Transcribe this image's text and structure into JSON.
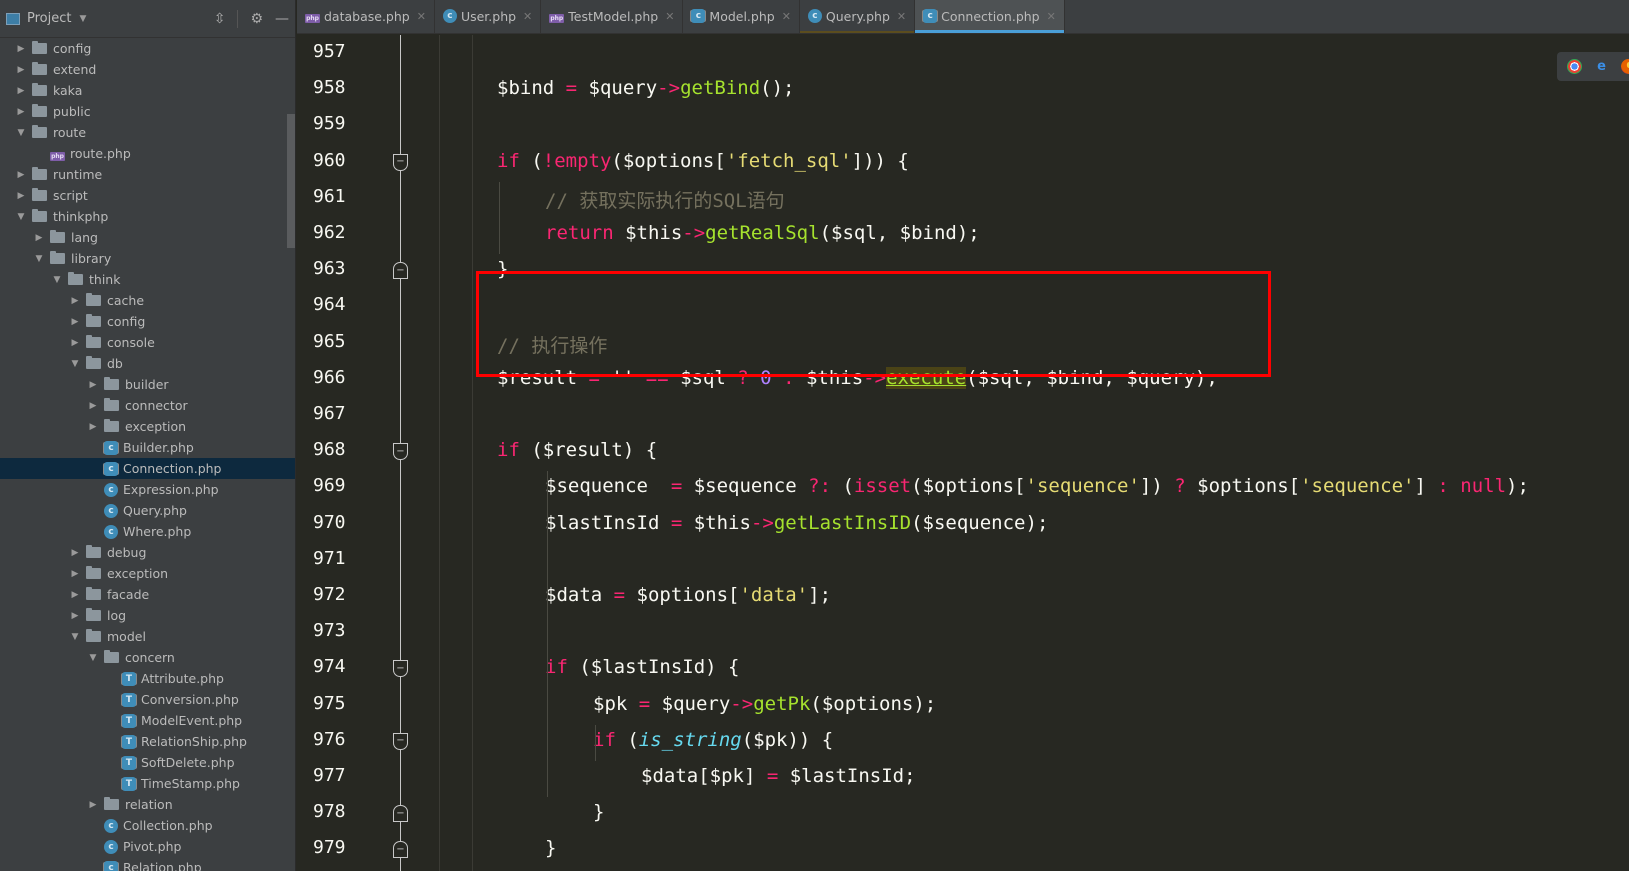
{
  "sidebar": {
    "title": "Project",
    "tools": [
      "collapse-all-icon",
      "gear-icon",
      "minimize-icon"
    ],
    "items": [
      {
        "label": "config",
        "type": "folder",
        "depth": 0,
        "expanded": false
      },
      {
        "label": "extend",
        "type": "folder",
        "depth": 0,
        "expanded": false
      },
      {
        "label": "kaka",
        "type": "folder",
        "depth": 0,
        "expanded": false
      },
      {
        "label": "public",
        "type": "folder",
        "depth": 0,
        "expanded": false
      },
      {
        "label": "route",
        "type": "folder",
        "depth": 0,
        "expanded": true
      },
      {
        "label": "route.php",
        "type": "php",
        "depth": 1
      },
      {
        "label": "runtime",
        "type": "folder",
        "depth": 0,
        "expanded": false
      },
      {
        "label": "script",
        "type": "folder",
        "depth": 0,
        "expanded": false
      },
      {
        "label": "thinkphp",
        "type": "folder",
        "depth": 0,
        "expanded": true
      },
      {
        "label": "lang",
        "type": "folder",
        "depth": 1,
        "expanded": false
      },
      {
        "label": "library",
        "type": "folder",
        "depth": 1,
        "expanded": true
      },
      {
        "label": "think",
        "type": "folder",
        "depth": 2,
        "expanded": true
      },
      {
        "label": "cache",
        "type": "folder",
        "depth": 3,
        "expanded": false
      },
      {
        "label": "config",
        "type": "folder",
        "depth": 3,
        "expanded": false
      },
      {
        "label": "console",
        "type": "folder",
        "depth": 3,
        "expanded": false
      },
      {
        "label": "db",
        "type": "folder",
        "depth": 3,
        "expanded": true
      },
      {
        "label": "builder",
        "type": "folder",
        "depth": 4,
        "expanded": false
      },
      {
        "label": "connector",
        "type": "folder",
        "depth": 4,
        "expanded": false
      },
      {
        "label": "exception",
        "type": "folder",
        "depth": 4,
        "expanded": false
      },
      {
        "label": "Builder.php",
        "type": "abstract-class",
        "depth": 4
      },
      {
        "label": "Connection.php",
        "type": "abstract-class",
        "depth": 4,
        "selected": true
      },
      {
        "label": "Expression.php",
        "type": "class",
        "depth": 4
      },
      {
        "label": "Query.php",
        "type": "class",
        "depth": 4
      },
      {
        "label": "Where.php",
        "type": "class",
        "depth": 4
      },
      {
        "label": "debug",
        "type": "folder",
        "depth": 3,
        "expanded": false
      },
      {
        "label": "exception",
        "type": "folder",
        "depth": 3,
        "expanded": false
      },
      {
        "label": "facade",
        "type": "folder",
        "depth": 3,
        "expanded": false
      },
      {
        "label": "log",
        "type": "folder",
        "depth": 3,
        "expanded": false
      },
      {
        "label": "model",
        "type": "folder",
        "depth": 3,
        "expanded": true
      },
      {
        "label": "concern",
        "type": "folder",
        "depth": 4,
        "expanded": true
      },
      {
        "label": "Attribute.php",
        "type": "trait",
        "depth": 5
      },
      {
        "label": "Conversion.php",
        "type": "trait",
        "depth": 5
      },
      {
        "label": "ModelEvent.php",
        "type": "trait",
        "depth": 5
      },
      {
        "label": "RelationShip.php",
        "type": "trait",
        "depth": 5
      },
      {
        "label": "SoftDelete.php",
        "type": "trait",
        "depth": 5
      },
      {
        "label": "TimeStamp.php",
        "type": "trait",
        "depth": 5
      },
      {
        "label": "relation",
        "type": "folder",
        "depth": 4,
        "expanded": false
      },
      {
        "label": "Collection.php",
        "type": "class",
        "depth": 4
      },
      {
        "label": "Pivot.php",
        "type": "class",
        "depth": 4
      },
      {
        "label": "Relation.php",
        "type": "abstract-class",
        "depth": 4
      }
    ]
  },
  "tabs": [
    {
      "label": "database.php",
      "icon": "php",
      "active": false
    },
    {
      "label": "User.php",
      "icon": "class",
      "active": false
    },
    {
      "label": "TestModel.php",
      "icon": "php",
      "active": false
    },
    {
      "label": "Model.php",
      "icon": "abstract-class",
      "active": false
    },
    {
      "label": "Query.php",
      "icon": "class",
      "active": false
    },
    {
      "label": "Connection.php",
      "icon": "abstract-class",
      "active": true
    }
  ],
  "editor": {
    "lines": [
      {
        "n": "957",
        "indent": 0,
        "tokens": []
      },
      {
        "n": "958",
        "indent": 0,
        "tokens": [
          [
            "",
            "$bind "
          ],
          [
            "kw",
            "="
          ],
          [
            "",
            " $query"
          ],
          [
            "kw",
            "->"
          ],
          [
            "fn",
            "getBind"
          ],
          [
            "",
            "();"
          ]
        ]
      },
      {
        "n": "959",
        "indent": 0,
        "tokens": []
      },
      {
        "n": "960",
        "indent": 0,
        "fold": "open",
        "tokens": [
          [
            "kw",
            "if"
          ],
          [
            "",
            " ("
          ],
          [
            "kw",
            "!empty"
          ],
          [
            "",
            "($options["
          ],
          [
            "str",
            "'fetch_sql'"
          ],
          [
            "",
            "])) {"
          ]
        ]
      },
      {
        "n": "961",
        "indent": 1,
        "tokens": [
          [
            "cm",
            "// 获取实际执行的SQL语句"
          ]
        ]
      },
      {
        "n": "962",
        "indent": 1,
        "tokens": [
          [
            "kw",
            "return"
          ],
          [
            "",
            " $this"
          ],
          [
            "kw",
            "->"
          ],
          [
            "fn",
            "getRealSql"
          ],
          [
            "",
            "($sql, $bind);"
          ]
        ]
      },
      {
        "n": "963",
        "indent": 0,
        "fold": "close",
        "tokens": [
          [
            "",
            "}"
          ]
        ]
      },
      {
        "n": "964",
        "indent": 0,
        "tokens": []
      },
      {
        "n": "965",
        "indent": 0,
        "tokens": [
          [
            "cm",
            "// 执行操作"
          ]
        ]
      },
      {
        "n": "966",
        "indent": 0,
        "tokens": [
          [
            "",
            "$result "
          ],
          [
            "kw",
            "="
          ],
          [
            "",
            " '' "
          ],
          [
            "kw",
            "=="
          ],
          [
            "",
            " $sql "
          ],
          [
            "kw",
            "?"
          ],
          [
            "",
            " "
          ],
          [
            "num",
            "0"
          ],
          [
            "",
            " "
          ],
          [
            "kw",
            ":"
          ],
          [
            "",
            " $this"
          ],
          [
            "kw",
            "->"
          ],
          [
            "fnhl",
            "execute"
          ],
          [
            "",
            "($sql, $bind, $query);"
          ]
        ]
      },
      {
        "n": "967",
        "indent": 0,
        "tokens": []
      },
      {
        "n": "968",
        "indent": 0,
        "fold": "open",
        "tokens": [
          [
            "kw",
            "if"
          ],
          [
            "",
            " ($result) {"
          ]
        ]
      },
      {
        "n": "969",
        "indent": 1,
        "tokens": [
          [
            "",
            "$sequence  "
          ],
          [
            "kw",
            "="
          ],
          [
            "",
            " $sequence "
          ],
          [
            "kw",
            "?:"
          ],
          [
            "",
            " ("
          ],
          [
            "kw",
            "isset"
          ],
          [
            "",
            "($options["
          ],
          [
            "str",
            "'sequence'"
          ],
          [
            "",
            "]) "
          ],
          [
            "kw",
            "?"
          ],
          [
            "",
            " $options["
          ],
          [
            "str",
            "'sequence'"
          ],
          [
            "",
            "] "
          ],
          [
            "kw",
            ":"
          ],
          [
            "",
            " "
          ],
          [
            "kw",
            "null"
          ],
          [
            "",
            ");"
          ]
        ]
      },
      {
        "n": "970",
        "indent": 1,
        "tokens": [
          [
            "",
            "$lastInsId "
          ],
          [
            "kw",
            "="
          ],
          [
            "",
            " $this"
          ],
          [
            "kw",
            "->"
          ],
          [
            "fn",
            "getLastInsID"
          ],
          [
            "",
            "($sequence);"
          ]
        ]
      },
      {
        "n": "971",
        "indent": 1,
        "tokens": []
      },
      {
        "n": "972",
        "indent": 1,
        "tokens": [
          [
            "",
            "$data "
          ],
          [
            "kw",
            "="
          ],
          [
            "",
            " $options["
          ],
          [
            "str",
            "'data'"
          ],
          [
            "",
            "];"
          ]
        ]
      },
      {
        "n": "973",
        "indent": 1,
        "tokens": []
      },
      {
        "n": "974",
        "indent": 1,
        "fold": "open",
        "tokens": [
          [
            "kw",
            "if"
          ],
          [
            "",
            " ($lastInsId) {"
          ]
        ]
      },
      {
        "n": "975",
        "indent": 2,
        "tokens": [
          [
            "",
            "$pk "
          ],
          [
            "kw",
            "="
          ],
          [
            "",
            " $query"
          ],
          [
            "kw",
            "->"
          ],
          [
            "fn",
            "getPk"
          ],
          [
            "",
            "($options);"
          ]
        ]
      },
      {
        "n": "976",
        "indent": 2,
        "fold": "open",
        "tokens": [
          [
            "kw",
            "if"
          ],
          [
            "",
            " ("
          ],
          [
            "bi",
            "is_string"
          ],
          [
            "",
            "($pk)) {"
          ]
        ]
      },
      {
        "n": "977",
        "indent": 3,
        "tokens": [
          [
            "",
            "$data[$pk] "
          ],
          [
            "kw",
            "="
          ],
          [
            "",
            " $lastInsId;"
          ]
        ]
      },
      {
        "n": "978",
        "indent": 2,
        "fold": "close",
        "tokens": [
          [
            "",
            "}"
          ]
        ]
      },
      {
        "n": "979",
        "indent": 1,
        "fold": "close",
        "tokens": [
          [
            "",
            "}"
          ]
        ]
      }
    ]
  },
  "browser_popup": [
    "chrome-icon",
    "edge-icon",
    "firefox-icon"
  ],
  "colors": {
    "keyword": "#f92672",
    "function": "#a6e22e",
    "string": "#e6db74",
    "number": "#ae81ff",
    "comment": "#75715e",
    "highlight_box": "#ff0000"
  }
}
